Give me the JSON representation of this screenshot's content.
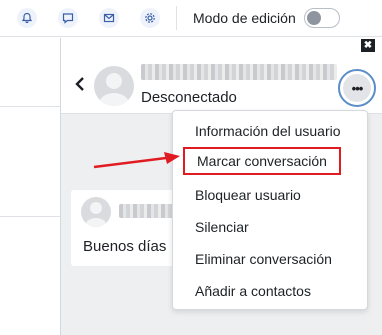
{
  "navbar": {
    "icons": [
      "bell-icon",
      "chat-icon",
      "mail-icon",
      "gear-icon"
    ],
    "edit_mode_label": "Modo de edición",
    "edit_mode_on": false
  },
  "drawer": {
    "close_label": "✖",
    "status": "Desconectado",
    "more_label": "•••"
  },
  "message": {
    "text": "Buenos días"
  },
  "menu": {
    "items": [
      "Información del usuario",
      "Marcar conversación",
      "Bloquear usuario",
      "Silenciar",
      "Eliminar conversación",
      "Añadir a contactos"
    ],
    "highlighted_index": 1
  },
  "colors": {
    "accent": "#0f6cbf",
    "annotation": "#e11b22",
    "drawer_bg": "#eeeff1"
  }
}
